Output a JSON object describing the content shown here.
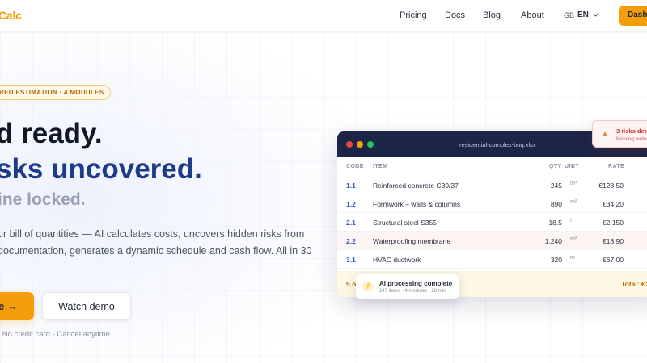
{
  "nav": {
    "logo": "Calc",
    "links": [
      "Pricing",
      "Docs",
      "Blog",
      "About"
    ],
    "lang_code": "GB",
    "lang_label": "EN",
    "dashboard": "Dashb"
  },
  "hero": {
    "badge": "RED ESTIMATION · 4 MODULES",
    "line1": "d ready.",
    "line2": "sks uncovered.",
    "line3": "ine locked.",
    "desc1": "ur bill of quantities — AI calculates costs, uncovers hidden risks from",
    "desc2": "documentation, generates a dynamic schedule and cash flow. All in 30",
    "cta_primary": "e →",
    "cta_secondary": "Watch demo",
    "fine_print": "· No credit card · Cancel anytime"
  },
  "window": {
    "filename": "residential-complex-boq.xlsx",
    "dot_colors": [
      "#ef4444",
      "#f59e0b",
      "#22c55e"
    ],
    "headers": {
      "code": "CODE",
      "item": "ITEM",
      "qty": "QTY",
      "unit": "UNIT",
      "rate": "RATE"
    },
    "rows": [
      {
        "code": "1.1",
        "item": "Reinforced concrete C30/37",
        "qty": "245",
        "unit": "m³",
        "rate": "€128.50"
      },
      {
        "code": "1.2",
        "item": "Formwork – walls & columns",
        "qty": "890",
        "unit": "m²",
        "rate": "€34.20"
      },
      {
        "code": "2.1",
        "item": "Structural steel S355",
        "qty": "18.5",
        "unit": "t",
        "rate": "€2,150"
      },
      {
        "code": "2.2",
        "item": "Waterproofing membrane",
        "qty": "1,240",
        "unit": "m²",
        "rate": "€18.90"
      },
      {
        "code": "3.1",
        "item": "HVAC ductwork",
        "qty": "320",
        "unit": "m",
        "rate": "€67.00"
      }
    ],
    "footer_left": "5 o",
    "footer_right": "Total: €1"
  },
  "toast": {
    "title": "AI processing complete",
    "subtitle": "247 items · 4 modules · 28 min"
  },
  "risk": {
    "title": "3 risks dete",
    "subtitle": "Missing wate"
  }
}
